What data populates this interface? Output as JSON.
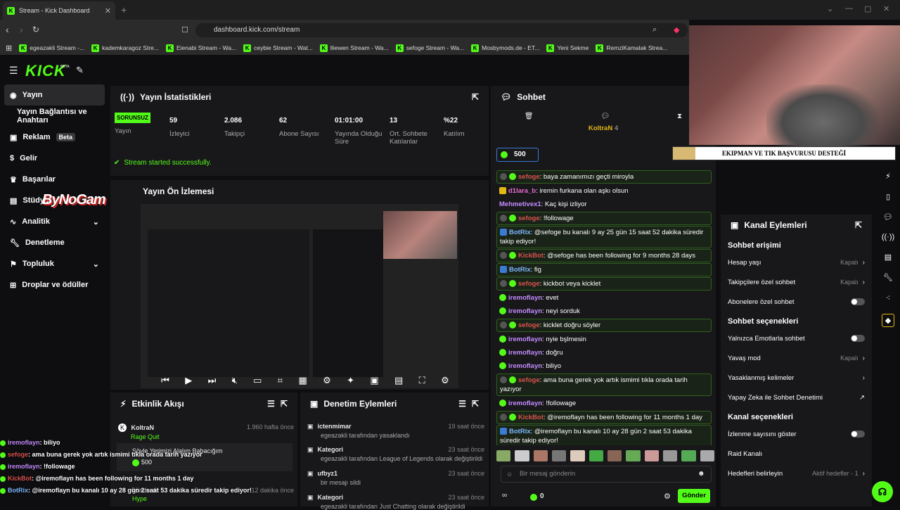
{
  "browser": {
    "tab_title": "Stream - Kick Dashboard",
    "url": "dashboard.kick.com/stream",
    "bookmarks": [
      "egeazakli Stream -...",
      "kademkaragoz Stre...",
      "Eienabi Stream - Wa...",
      "ceybie Stream - Wat...",
      "lliewen Stream - Wa...",
      "sefoge Stream - Wa...",
      "Mosbymods.de - ET...",
      "Yeni Sekme",
      "RemziKamalak Strea..."
    ]
  },
  "logo": {
    "text": "KICK",
    "beta": "BETA"
  },
  "sidebar": {
    "items": [
      {
        "label": "Yayın"
      },
      {
        "label": "Yayın Bağlantısı ve Anahtarı"
      },
      {
        "label": "Reklam",
        "badge": "Beta"
      },
      {
        "label": "Gelir"
      },
      {
        "label": "Başarılar"
      },
      {
        "label": "Stüdyo"
      },
      {
        "label": "Analitik"
      },
      {
        "label": "Denetleme"
      },
      {
        "label": "Topluluk"
      },
      {
        "label": "Droplar ve ödüller"
      }
    ]
  },
  "stats": {
    "title": "Yayın İstatistikleri",
    "status": "SORUNSUZ",
    "status_label": "Yayın",
    "items": [
      {
        "value": "59",
        "label": "İzleyici"
      },
      {
        "value": "2.086",
        "label": "Takipçi"
      },
      {
        "value": "62",
        "label": "Abone Sayısı"
      },
      {
        "value": "01:01:00",
        "label": "Yayında Olduğu Süre"
      },
      {
        "value": "13",
        "label": "Ort. Sohbete Katılanlar"
      },
      {
        "value": "%22",
        "label": "Katılım"
      }
    ],
    "success": "Stream started successfully."
  },
  "preview": {
    "title": "Yayın Ön İzlemesi"
  },
  "overlay_brand": "ByNoGam",
  "activity": {
    "title": "Etkinlik Akışı",
    "events": [
      {
        "user": "KoltraN",
        "detail": "Rage Quit",
        "time": "1.960 hafta önce"
      },
      {
        "user": "Söyle Yerimizi Alalım Babacığım",
        "detail": "500",
        "time": ""
      },
      {
        "user": "gönderdi",
        "detail": "Hype",
        "time": "12 dakika önce"
      }
    ]
  },
  "moderation": {
    "title": "Denetim Eylemleri",
    "events": [
      {
        "title": "ictenmimar",
        "sub": "egeazakli tarafından yasaklandı",
        "time": "19 saat önce"
      },
      {
        "title": "Kategori",
        "sub": "egeazakli tarafından League of Legends olarak değiştirildi",
        "time": "23 saat önce"
      },
      {
        "title": "ufbyz1",
        "sub": "bir mesajı sildi",
        "time": "23 saat önce"
      },
      {
        "title": "Kategori",
        "sub": "egeazakli tarafından Just Chatting olarak değiştirildi",
        "time": "23 saat önce"
      }
    ]
  },
  "chat": {
    "title": "Sohbet",
    "pinned_user": "KoltraN",
    "pinned_count": "4",
    "coins": "500",
    "messages": [
      {
        "user": "sefoge",
        "text": ": baya zamanımızı geçti miroyla",
        "cls": "user-red",
        "hl": true
      },
      {
        "user": "d1lara_b",
        "text": ": iremin furkana olan aşkı olsun",
        "cls": "user-pink",
        "hl": false
      },
      {
        "user": "Mehmetivex1",
        "text": ": Kaç kişi izliyor",
        "cls": "user-purple",
        "hl": false
      },
      {
        "user": "sefoge",
        "text": ": !followage",
        "cls": "user-red",
        "hl": true
      },
      {
        "user": "BotRix",
        "text": ": @sefoge bu kanalı 9 ay 25 gün 15 saat 52 dakika süredir takip ediyor!",
        "cls": "user-blue",
        "hl": true
      },
      {
        "user": "KickBot",
        "text": ": @sefoge has been following for 9 months 28 days",
        "cls": "user-red",
        "hl": true
      },
      {
        "user": "BotRix",
        "text": ": fig",
        "cls": "user-blue",
        "hl": true
      },
      {
        "user": "sefoge",
        "text": ": kickbot veya kicklet",
        "cls": "user-red",
        "hl": true
      },
      {
        "user": "iremoflayn",
        "text": ": evet",
        "cls": "user-purple",
        "hl": false
      },
      {
        "user": "iremoflayn",
        "text": ": neyi sorduk",
        "cls": "user-purple",
        "hl": false
      },
      {
        "user": "sefoge",
        "text": ": kicklet doğru söyler",
        "cls": "user-red",
        "hl": true
      },
      {
        "user": "iremoflayn",
        "text": ": nyie bşlmesin",
        "cls": "user-purple",
        "hl": false
      },
      {
        "user": "iremoflayn",
        "text": ": doğru",
        "cls": "user-purple",
        "hl": false
      },
      {
        "user": "iremoflayn",
        "text": ": biliyo",
        "cls": "user-purple",
        "hl": false
      },
      {
        "user": "sefoge",
        "text": ": ama buna gerek yok artık ismimi tıkla orada tarih yazıyor",
        "cls": "user-red",
        "hl": true
      },
      {
        "user": "iremoflayn",
        "text": ": !followage",
        "cls": "user-purple",
        "hl": false
      },
      {
        "user": "KickBot",
        "text": ": @iremoflayn has been following for 11 months 1 day",
        "cls": "user-red",
        "hl": true
      },
      {
        "user": "BotRix",
        "text": ": @iremoflayn bu kanalı 10 ay 28 gün 2 saat 53 dakika süredir takip ediyor!",
        "cls": "user-blue",
        "hl": true
      }
    ],
    "placeholder": "Bir mesaj gönderin",
    "send": "Gönder",
    "points": "0"
  },
  "channel_actions": {
    "title": "Kanal Eylemleri",
    "sections": [
      {
        "title": "Sohbet erişimi",
        "rows": [
          {
            "label": "Hesap yaşı",
            "value": "Kapalı",
            "type": "chev"
          },
          {
            "label": "Takipçilere özel sohbet",
            "value": "Kapalı",
            "type": "chev"
          },
          {
            "label": "Abonelere özel sohbet",
            "value": "",
            "type": "toggle"
          }
        ]
      },
      {
        "title": "Sohbet seçenekleri",
        "rows": [
          {
            "label": "Yalnızca Emotlarla sohbet",
            "value": "",
            "type": "toggle"
          },
          {
            "label": "Yavaş mod",
            "value": "Kapalı",
            "type": "chev"
          },
          {
            "label": "Yasaklanmış kelimeler",
            "value": "",
            "type": "chev"
          },
          {
            "label": "Yapay Zeka ile Sohbet Denetimi",
            "value": "",
            "type": "ext"
          }
        ]
      },
      {
        "title": "Kanal seçenekleri",
        "rows": [
          {
            "label": "İzlenme sayısını göster",
            "value": "",
            "type": "toggle"
          },
          {
            "label": "Raid Kanalı",
            "value": "",
            "type": "none"
          },
          {
            "label": "Hedefleri belirleyin",
            "value": "Aktif hedefler - 1",
            "type": "chev"
          }
        ]
      }
    ]
  },
  "webcam_banner": "EKIPMAN VE TIK BAŞVURUSU DESTEĞİ",
  "overlay_chat": [
    {
      "user": "iremoflayn",
      "text": ": biliyo"
    },
    {
      "user": "sefoge",
      "text": ": ama buna gerek yok artık ismimi tıkla orada tarih yazıyor"
    },
    {
      "user": "iremoflayn",
      "text": ": !followage"
    },
    {
      "user": "KickBot",
      "text": ": @iremoflayn has been following for 11 months 1 day"
    },
    {
      "user": "BotRix",
      "text": ": @iremoflayn bu kanalı 10 ay 28 gün 2 saat 53 dakika süredir takip ediyor!"
    }
  ]
}
